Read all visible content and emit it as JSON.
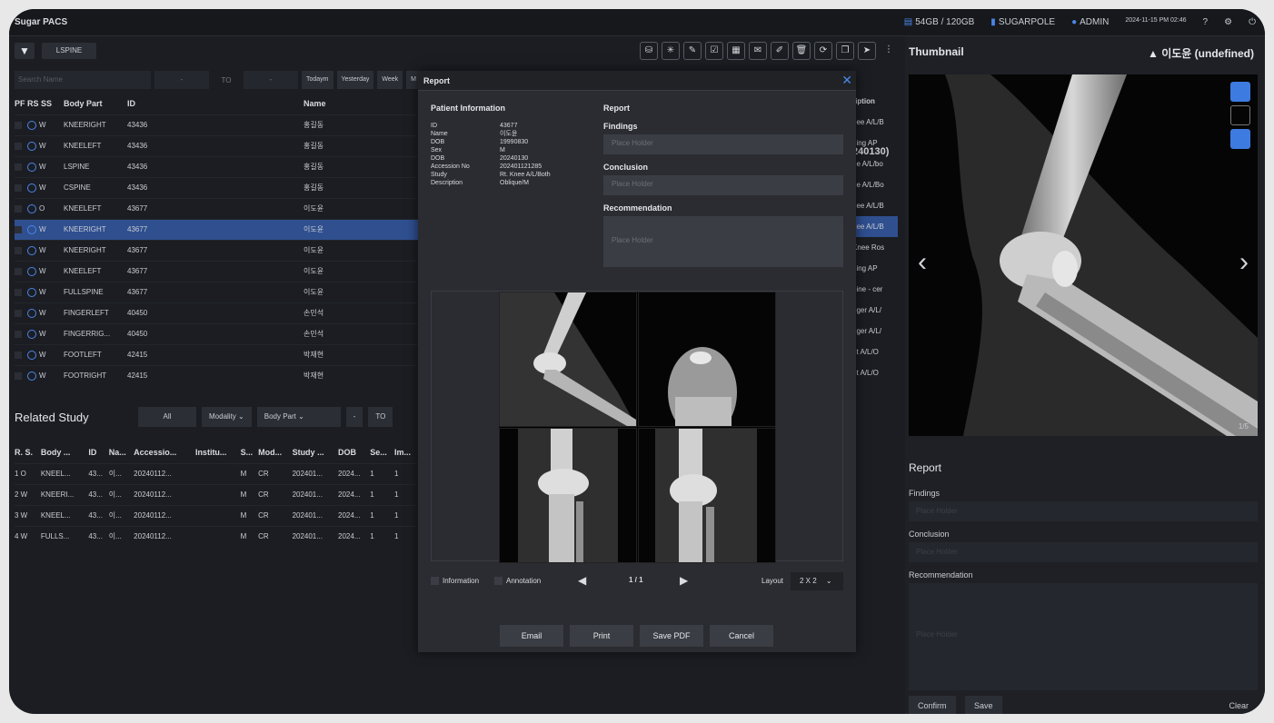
{
  "app": {
    "title": "Sugar PACS"
  },
  "header": {
    "storage": "54GB / 120GB",
    "org": "SUGARPOLE",
    "user": "ADMIN",
    "datetime": "2024-11-15 PM 02:46"
  },
  "toolbar": {
    "active_tab": "LSPINE"
  },
  "filters": {
    "search_placeholder": "Search Name",
    "from": "-",
    "to_label": "TO",
    "to": "-",
    "quick": [
      "Todaym",
      "Yesterday",
      "Week",
      "M"
    ]
  },
  "study_table": {
    "headers": [
      "PF RS SS",
      "Body Part",
      "ID",
      "Name"
    ],
    "rows": [
      {
        "status": "W",
        "body_part": "KNEERIGHT",
        "id": "43436",
        "name": "홍길동"
      },
      {
        "status": "W",
        "body_part": "KNEELEFT",
        "id": "43436",
        "name": "홍길동"
      },
      {
        "status": "W",
        "body_part": "LSPINE",
        "id": "43436",
        "name": "홍길동"
      },
      {
        "status": "W",
        "body_part": "CSPINE",
        "id": "43436",
        "name": "홍길동"
      },
      {
        "status": "O",
        "body_part": "KNEELEFT",
        "id": "43677",
        "name": "이도윤"
      },
      {
        "status": "W",
        "body_part": "KNEERIGHT",
        "id": "43677",
        "name": "이도윤"
      },
      {
        "status": "W",
        "body_part": "KNEERIGHT",
        "id": "43677",
        "name": "이도윤"
      },
      {
        "status": "W",
        "body_part": "KNEELEFT",
        "id": "43677",
        "name": "이도윤"
      },
      {
        "status": "W",
        "body_part": "FULLSPINE",
        "id": "43677",
        "name": "이도윤"
      },
      {
        "status": "W",
        "body_part": "FINGERLEFT",
        "id": "40450",
        "name": "손민석"
      },
      {
        "status": "W",
        "body_part": "FINGERRIG...",
        "id": "40450",
        "name": "손민석"
      },
      {
        "status": "W",
        "body_part": "FOOTLEFT",
        "id": "42415",
        "name": "박재현"
      },
      {
        "status": "W",
        "body_part": "FOOTRIGHT",
        "id": "42415",
        "name": "박재현"
      }
    ],
    "description_col_header": "ription",
    "description_col": [
      "nee A/L/B",
      "ding AP",
      "ne A/L/bo",
      "ne A/L/Bo",
      "nee A/L/B",
      "nee A/L/B",
      "Knee Ros",
      "ding AP",
      "pine - cer",
      "nger A/L/",
      "nger A/L/",
      "ot A/L/O",
      "ot A/L/O"
    ],
    "fragment": "240130)"
  },
  "related": {
    "title": "Related Study",
    "filters": {
      "all": "All",
      "modality": "Modality",
      "body_part": "Body Part",
      "from": "-",
      "to_label": "TO"
    },
    "headers": [
      "R. S.",
      "Body ...",
      "ID",
      "Na...",
      "Accessio...",
      "Institu...",
      "S...",
      "Mod...",
      "Study ...",
      "DOB",
      "Se...",
      "Im..."
    ],
    "rows": [
      [
        "1 O",
        "KNEEL...",
        "43...",
        "이...",
        "20240112...",
        "",
        "M",
        "CR",
        "202401...",
        "2024...",
        "1",
        "1"
      ],
      [
        "2 W",
        "KNEERI...",
        "43...",
        "이...",
        "20240112...",
        "",
        "M",
        "CR",
        "202401...",
        "2024...",
        "1",
        "1"
      ],
      [
        "3 W",
        "KNEEL...",
        "43...",
        "이...",
        "20240112...",
        "",
        "M",
        "CR",
        "202401...",
        "2024...",
        "1",
        "1"
      ],
      [
        "4 W",
        "FULLS...",
        "43...",
        "이...",
        "20240112...",
        "",
        "M",
        "CR",
        "202401...",
        "2024...",
        "1",
        "1"
      ]
    ]
  },
  "right_panel": {
    "title": "Thumbnail",
    "user": "이도윤 (undefined)",
    "page": "1/5",
    "report_title": "Report",
    "findings_label": "Findings",
    "conclusion_label": "Conclusion",
    "recommendation_label": "Recommendation",
    "placeholder": "Place Holder",
    "buttons": {
      "confirm": "Confirm",
      "save": "Save",
      "clear": "Clear"
    }
  },
  "modal": {
    "title": "Report",
    "patient_info_title": "Patient Information",
    "patient": [
      {
        "k": "ID",
        "v": "43677"
      },
      {
        "k": "Name",
        "v": "이도윤"
      },
      {
        "k": "DOB",
        "v": "19990830"
      },
      {
        "k": "Sex",
        "v": "M"
      },
      {
        "k": "DOB",
        "v": "20240130"
      },
      {
        "k": "Accession No",
        "v": "202401121285"
      },
      {
        "k": "Study",
        "v": "Rt. Knee A/L/Both"
      },
      {
        "k": "Description",
        "v": "Oblique/M"
      }
    ],
    "report_title": "Report",
    "findings_label": "Findings",
    "conclusion_label": "Conclusion",
    "recommendation_label": "Recommendation",
    "placeholder": "Place Holder",
    "information_label": "Information",
    "annotation_label": "Annotation",
    "page": "1 / 1",
    "layout_label": "Layout",
    "layout_value": "2 X 2",
    "buttons": {
      "email": "Email",
      "print": "Print",
      "save_pdf": "Save PDF",
      "cancel": "Cancel"
    }
  },
  "colors": {
    "accent": "#4a86e8",
    "selected_row": "#2f4f8f"
  }
}
